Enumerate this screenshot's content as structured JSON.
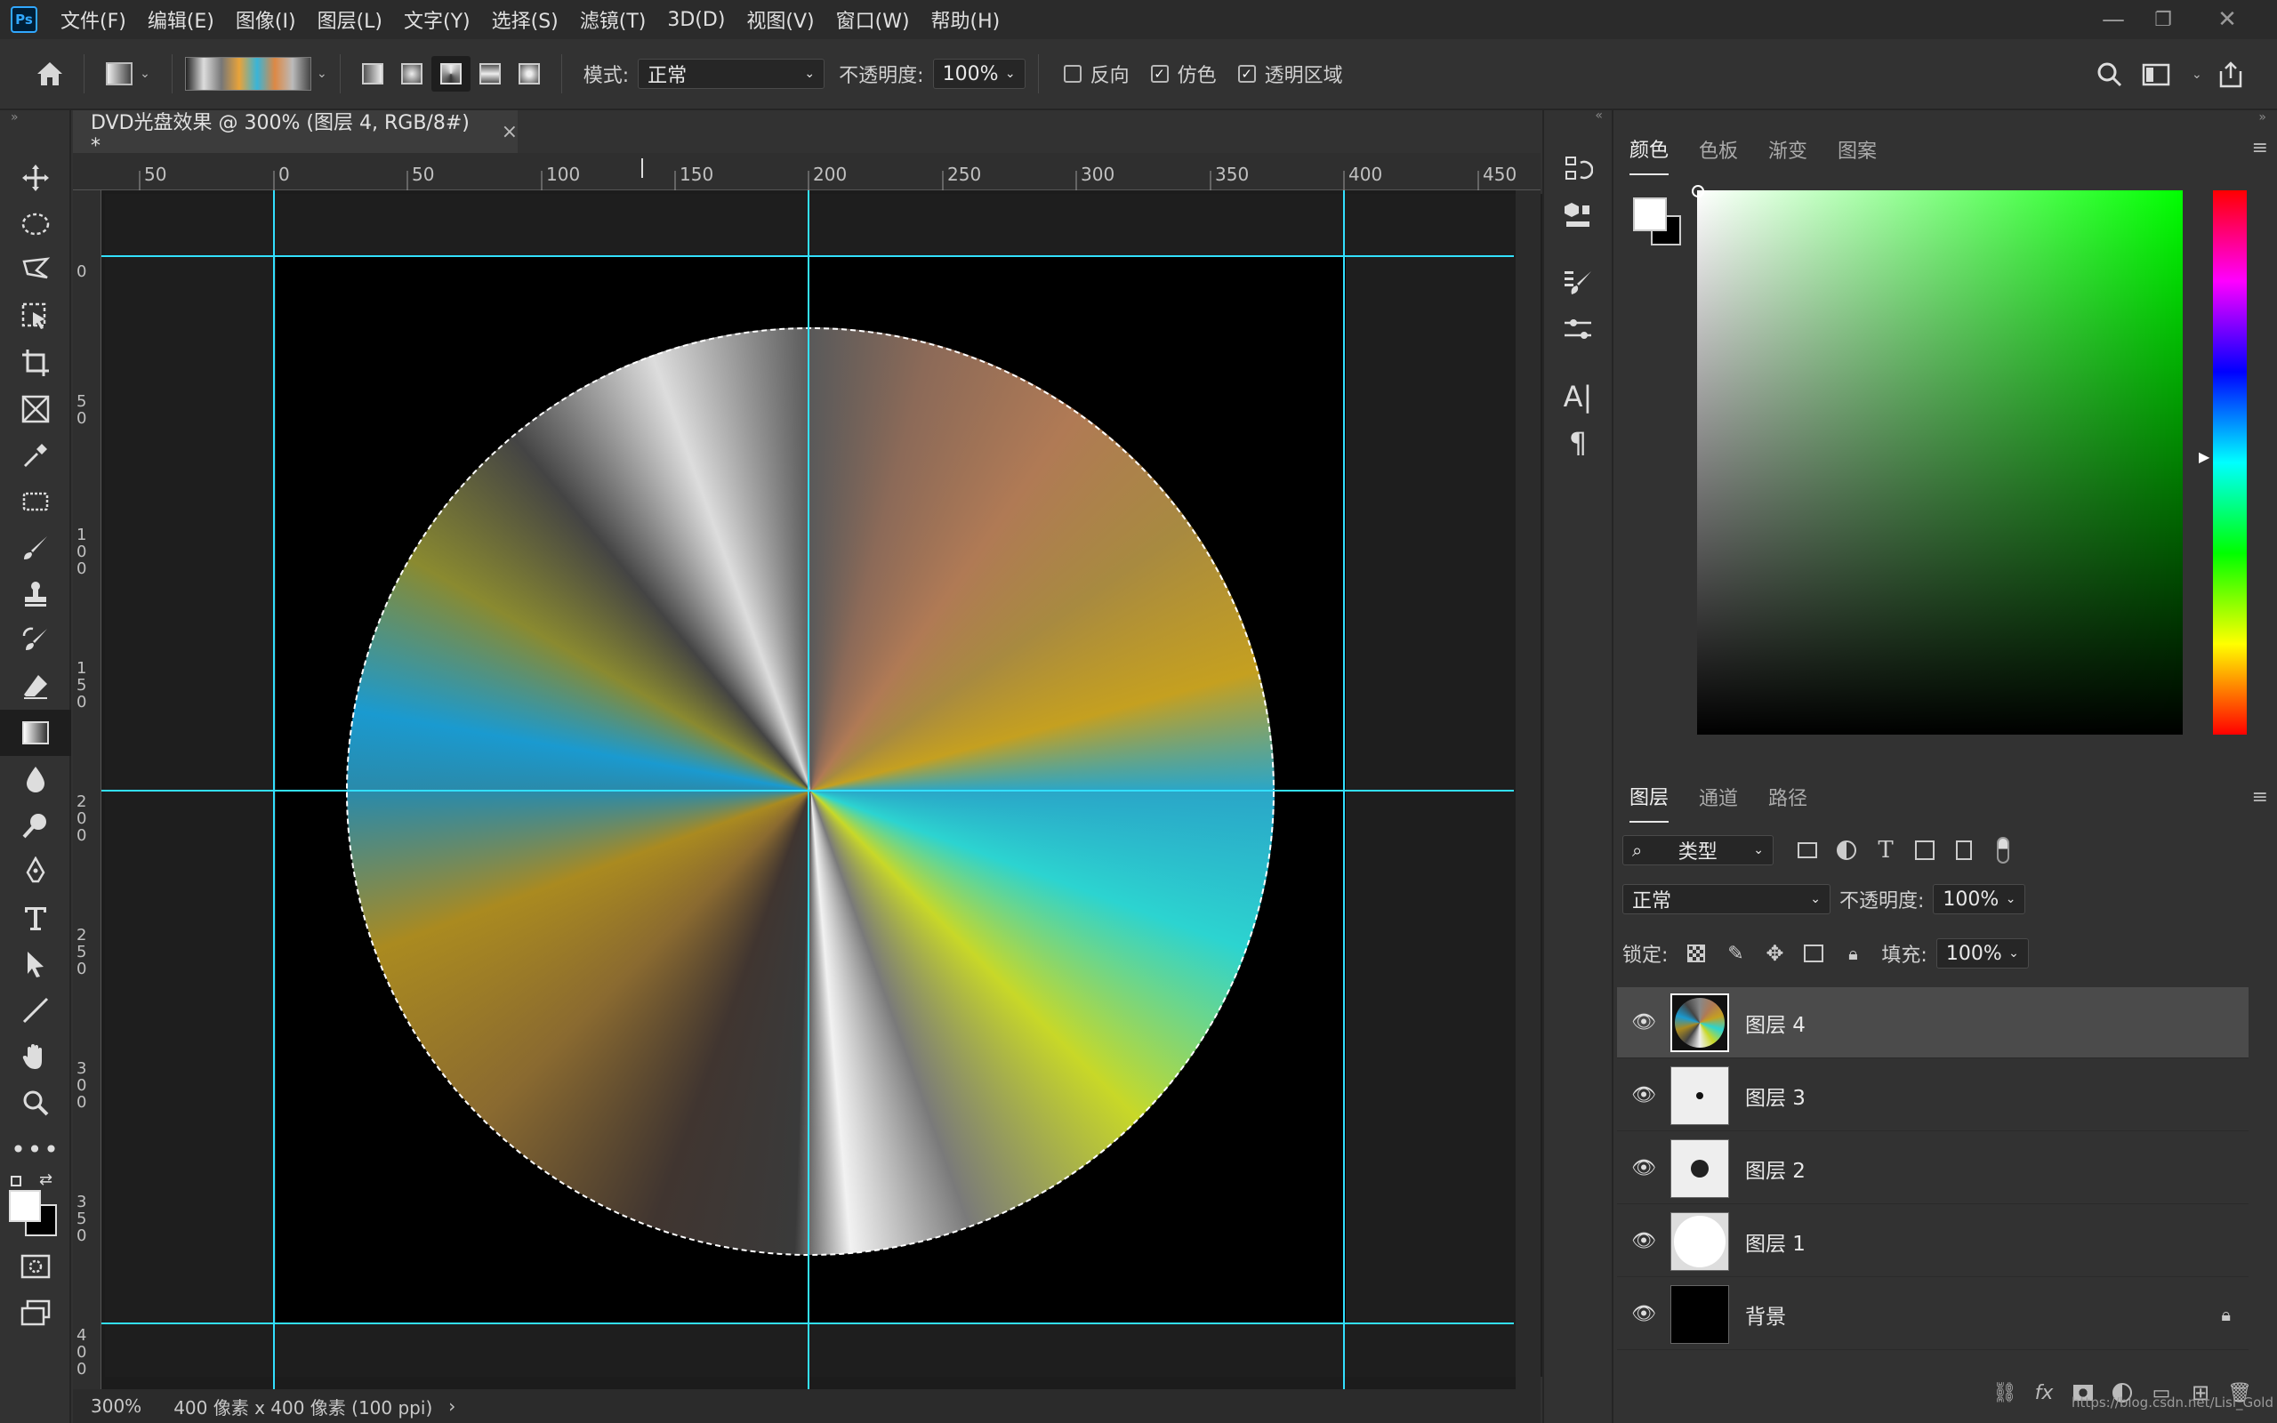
{
  "app": {
    "logo_text": "Ps"
  },
  "menu": [
    "文件(F)",
    "编辑(E)",
    "图像(I)",
    "图层(L)",
    "文字(Y)",
    "选择(S)",
    "滤镜(T)",
    "3D(D)",
    "视图(V)",
    "窗口(W)",
    "帮助(H)"
  ],
  "options": {
    "mode_label": "模式:",
    "mode_value": "正常",
    "opacity_label": "不透明度:",
    "opacity_value": "100%",
    "reverse_label": "反向",
    "reverse_checked": false,
    "dither_label": "仿色",
    "dither_checked": true,
    "transparency_label": "透明区域",
    "transparency_checked": true
  },
  "document": {
    "tab_title": "DVD光盘效果 @ 300% (图层 4, RGB/8#) *",
    "close_glyph": "×",
    "ruler_h_labels": [
      "50",
      "0",
      "50",
      "100",
      "150",
      "200",
      "250",
      "300",
      "350",
      "400",
      "450"
    ],
    "ruler_v_labels": [
      "0",
      "5\n0",
      "1\n0\n0",
      "1\n5\n0",
      "2\n0\n0",
      "2\n5\n0",
      "3\n0\n0",
      "3\n5\n0",
      "4\n0\n0"
    ]
  },
  "status": {
    "zoom": "300%",
    "info": "400 像素 x 400 像素 (100 ppi)",
    "arrow": "›"
  },
  "color_panel": {
    "tabs": [
      "颜色",
      "色板",
      "渐变",
      "图案"
    ],
    "active_tab": 0,
    "foreground": "#ffffff",
    "background": "#000000",
    "hue_color": "#00ff00"
  },
  "layers_panel": {
    "tabs": [
      "图层",
      "通道",
      "路径"
    ],
    "active_tab": 0,
    "filter_label": "类型",
    "blend_mode": "正常",
    "opacity_label": "不透明度:",
    "opacity_value": "100%",
    "lock_label": "锁定:",
    "fill_label": "填充:",
    "fill_value": "100%",
    "layers": [
      {
        "name": "图层 4",
        "selected": true
      },
      {
        "name": "图层 3",
        "selected": false
      },
      {
        "name": "图层 2",
        "selected": false
      },
      {
        "name": "图层 1",
        "selected": false
      },
      {
        "name": "背景",
        "selected": false
      }
    ]
  },
  "watermark": "https://blog.csdn.net/Lisi_Gold"
}
